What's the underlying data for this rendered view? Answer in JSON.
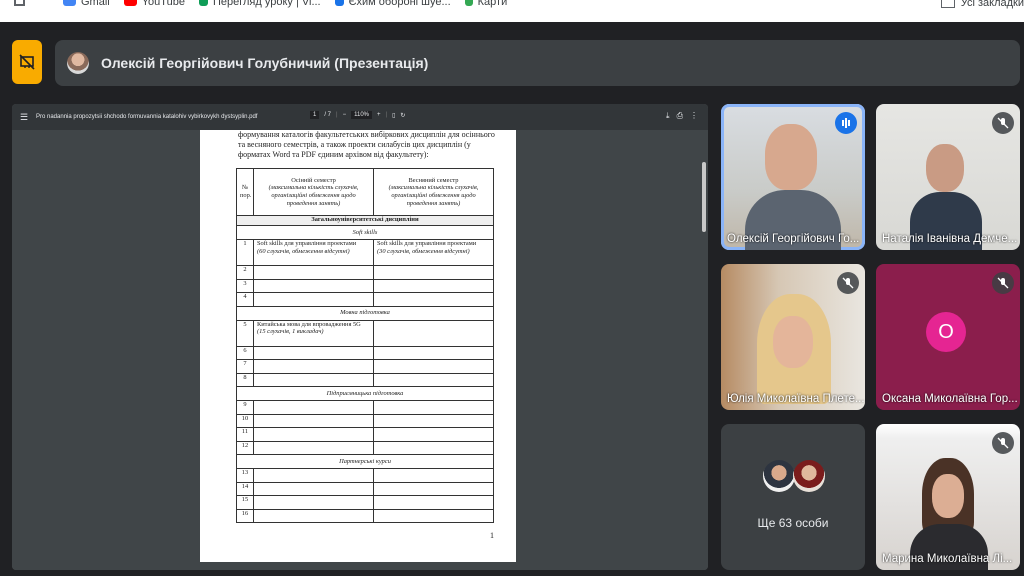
{
  "bookmarks": {
    "items": [
      {
        "label": "Gmail",
        "icon": "gmail-icon",
        "color": "#4285f4"
      },
      {
        "label": "YouTube",
        "icon": "youtube-icon",
        "color": "#ff0000"
      },
      {
        "label": "Перегляд уроку | Vi...",
        "icon": "course-icon",
        "color": "#0f9d58"
      },
      {
        "label": "Єхим обороні шуе...",
        "icon": "link-icon",
        "color": "#1a73e8"
      },
      {
        "label": "Карти",
        "icon": "maps-icon",
        "color": "#34a853"
      }
    ],
    "all_bookmarks_label": "Усі закладки"
  },
  "header": {
    "title": "Олексій Георгійович Голубничий (Презентація)",
    "button_icon": "presentation-off-icon",
    "accent": "#f9ab00"
  },
  "pdf": {
    "file_name": "Pro nadannia propozytsii shchodo formuvannia katalohiv vybirkovykh dystsyplin.pdf",
    "page_current": "1",
    "page_total": "/ 7",
    "zoom": "110%",
    "intro_text": "формування каталогів факультетських вибіркових дисциплін для осіннього та весняного семестрів, а також проекти силабусів цих дисциплін (у форматах Word та PDF єдиним архівом від факультету):",
    "page_number": "1",
    "table": {
      "col_no": "№ пор.",
      "autumn_title": "Осінній семестр",
      "autumn_note": "(максимальна кількість слухачів, організаційні обмеження щодо проведення занять)",
      "spring_title": "Весняний семестр",
      "spring_note": "(максимальна кількість слухачів, організаційні обмеження щодо проведення занять)",
      "section_general": "Загальноуніверситетські дисципліни",
      "sub_soft": "Soft skills",
      "row1_no": "1",
      "row1_autumn": "Soft skills для управління проектами",
      "row1_autumn_note": "(60 слухачів, обмеження відсутні)",
      "row1_spring": "Soft skills для управління проектами",
      "row1_spring_note": "(30 слухачів, обмеження відсутні)",
      "sub_lang": "Мовна підготовка",
      "row5_no": "5",
      "row5_autumn": "Китайська мова для впровадження 5G",
      "row5_autumn_note": "(15 слухачів, 1 викладач)",
      "sub_entre": "Підприємницька підготовка",
      "sub_partner": "Партнерські курси",
      "nums": [
        "2",
        "3",
        "4",
        "6",
        "7",
        "8",
        "9",
        "10",
        "11",
        "12",
        "13",
        "14",
        "15",
        "16"
      ]
    }
  },
  "participants": [
    {
      "name": "Олексій Георгійович Го...",
      "state": "speaking"
    },
    {
      "name": "Наталія Іванівна Демче...",
      "state": "muted"
    },
    {
      "name": "Юлія Миколаївна Плете...",
      "state": "muted"
    },
    {
      "name": "Оксана Миколаївна Гор...",
      "state": "muted",
      "initial": "О",
      "avatar_color": "#e52592"
    },
    {
      "name": "Ще 63 особи",
      "state": "group"
    },
    {
      "name": "Марина Миколаївна Лі...",
      "state": "muted"
    }
  ]
}
